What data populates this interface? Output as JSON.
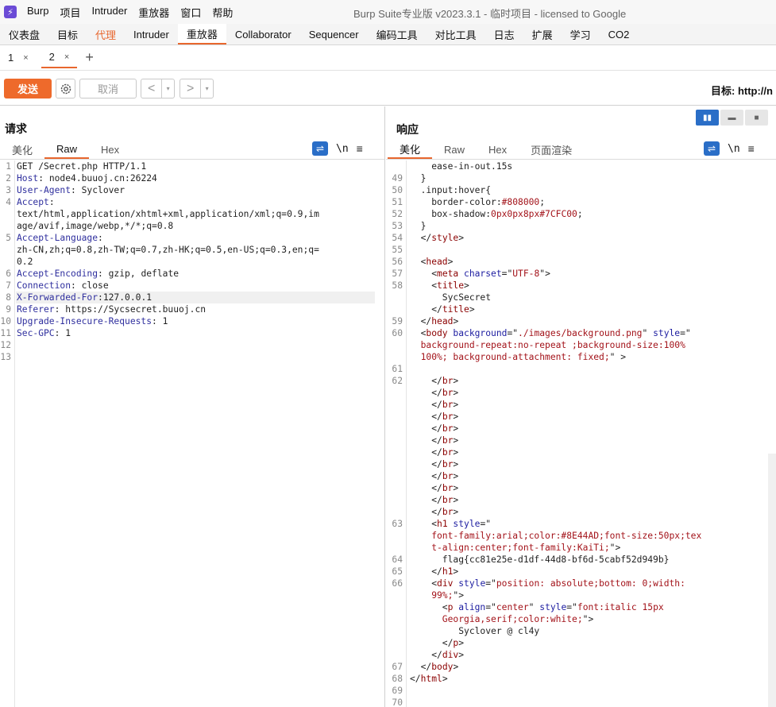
{
  "app": {
    "logo_glyph": "⚡",
    "menu": [
      "Burp",
      "项目",
      "Intruder",
      "重放器",
      "窗口",
      "帮助"
    ],
    "window_title": "Burp Suite专业版  v2023.3.1 - 临时项目 - licensed to Google"
  },
  "main_tabs": [
    "仪表盘",
    "目标",
    "代理",
    "Intruder",
    "重放器",
    "Collaborator",
    "Sequencer",
    "编码工具",
    "对比工具",
    "日志",
    "扩展",
    "学习",
    "CO2"
  ],
  "main_tab_active": "重放器",
  "sub_tabs": [
    {
      "label": "1",
      "close": "×"
    },
    {
      "label": "2",
      "close": "×"
    }
  ],
  "sub_tab_add": "+",
  "toolbar": {
    "send": "发送",
    "cancel": "取消",
    "back": "<",
    "forward": ">",
    "dropdown": "▾",
    "target_label": "目标: http://n"
  },
  "request": {
    "title": "请求",
    "tabs": [
      "美化",
      "Raw",
      "Hex"
    ],
    "active_tab": "Raw",
    "icons": {
      "wrap": "wrap-icon",
      "newline": "\\n",
      "menu": "≡"
    },
    "lines": [
      {
        "n": "1",
        "segs": [
          [
            "t",
            "GET /Secret.php HTTP/1.1"
          ]
        ]
      },
      {
        "n": "2",
        "segs": [
          [
            "k",
            "Host"
          ],
          [
            "t",
            ": node4.buuoj.cn:26224"
          ]
        ]
      },
      {
        "n": "3",
        "segs": [
          [
            "k",
            "User-Agent"
          ],
          [
            "t",
            ": Syclover"
          ]
        ]
      },
      {
        "n": "4",
        "segs": [
          [
            "k",
            "Accept"
          ],
          [
            "t",
            ":"
          ]
        ]
      },
      {
        "n": "",
        "segs": [
          [
            "t",
            "text/html,application/xhtml+xml,application/xml;q=0.9,im"
          ]
        ]
      },
      {
        "n": "",
        "segs": [
          [
            "t",
            "age/avif,image/webp,*/*;q=0.8"
          ]
        ]
      },
      {
        "n": "5",
        "segs": [
          [
            "k",
            "Accept-Language"
          ],
          [
            "t",
            ":"
          ]
        ]
      },
      {
        "n": "",
        "segs": [
          [
            "t",
            "zh-CN,zh;q=0.8,zh-TW;q=0.7,zh-HK;q=0.5,en-US;q=0.3,en;q="
          ]
        ]
      },
      {
        "n": "",
        "segs": [
          [
            "t",
            "0.2"
          ]
        ]
      },
      {
        "n": "6",
        "segs": [
          [
            "k",
            "Accept-Encoding"
          ],
          [
            "t",
            ": gzip, deflate"
          ]
        ]
      },
      {
        "n": "7",
        "segs": [
          [
            "k",
            "Connection"
          ],
          [
            "t",
            ": close"
          ]
        ]
      },
      {
        "n": "8",
        "segs": [
          [
            "k",
            "X-Forwarded-For"
          ],
          [
            "t",
            ":127.0.0.1"
          ]
        ],
        "highlight": true
      },
      {
        "n": "9",
        "segs": [
          [
            "k",
            "Referer"
          ],
          [
            "t",
            ": https://Sycsecret.buuoj.cn"
          ]
        ]
      },
      {
        "n": "10",
        "segs": [
          [
            "k",
            "Upgrade-Insecure-Requests"
          ],
          [
            "t",
            ": 1"
          ]
        ]
      },
      {
        "n": "11",
        "segs": [
          [
            "k",
            "Sec-GPC"
          ],
          [
            "t",
            ": 1"
          ]
        ]
      },
      {
        "n": "12",
        "segs": []
      },
      {
        "n": "13",
        "segs": []
      }
    ]
  },
  "response": {
    "title": "响应",
    "tabs": [
      "美化",
      "Raw",
      "Hex",
      "页面渲染"
    ],
    "active_tab": "美化",
    "icons": {
      "wrap": "wrap-icon",
      "newline": "\\n",
      "menu": "≡"
    },
    "layout_icons": [
      "split-horizontal-icon",
      "split-vertical-icon",
      "single-pane-icon"
    ],
    "lines": [
      {
        "n": "",
        "segs": [
          [
            "t",
            "    ease-in-out.15s"
          ]
        ]
      },
      {
        "n": "49",
        "segs": [
          [
            "t",
            "  }"
          ]
        ]
      },
      {
        "n": "50",
        "segs": [
          [
            "t",
            "  .input:hover{"
          ]
        ]
      },
      {
        "n": "51",
        "segs": [
          [
            "t",
            "    border-color:"
          ],
          [
            "v",
            "#808000"
          ],
          [
            "t",
            ";"
          ]
        ]
      },
      {
        "n": "52",
        "segs": [
          [
            "t",
            "    box-shadow:"
          ],
          [
            "v",
            "0px0px8px#7CFC00"
          ],
          [
            "t",
            ";"
          ]
        ]
      },
      {
        "n": "53",
        "segs": [
          [
            "t",
            "  }"
          ]
        ]
      },
      {
        "n": "54",
        "segs": [
          [
            "t",
            "  </"
          ],
          [
            "g",
            "style"
          ],
          [
            "t",
            ">"
          ]
        ]
      },
      {
        "n": "55",
        "segs": []
      },
      {
        "n": "56",
        "segs": [
          [
            "t",
            "  <"
          ],
          [
            "g",
            "head"
          ],
          [
            "t",
            ">"
          ]
        ]
      },
      {
        "n": "57",
        "segs": [
          [
            "t",
            "    <"
          ],
          [
            "g",
            "meta "
          ],
          [
            "a",
            "charset"
          ],
          [
            "t",
            "=\""
          ],
          [
            "v",
            "UTF-8"
          ],
          [
            "t",
            "\">"
          ]
        ]
      },
      {
        "n": "58",
        "segs": [
          [
            "t",
            "    <"
          ],
          [
            "g",
            "title"
          ],
          [
            "t",
            ">"
          ]
        ]
      },
      {
        "n": "",
        "segs": [
          [
            "t",
            "      SycSecret"
          ]
        ]
      },
      {
        "n": "",
        "segs": [
          [
            "t",
            "    </"
          ],
          [
            "g",
            "title"
          ],
          [
            "t",
            ">"
          ]
        ]
      },
      {
        "n": "59",
        "segs": [
          [
            "t",
            "  </"
          ],
          [
            "g",
            "head"
          ],
          [
            "t",
            ">"
          ]
        ]
      },
      {
        "n": "60",
        "segs": [
          [
            "t",
            "  <"
          ],
          [
            "g",
            "body "
          ],
          [
            "a",
            "background"
          ],
          [
            "t",
            "=\""
          ],
          [
            "v",
            "./images/background.png"
          ],
          [
            "t",
            "\" "
          ],
          [
            "a",
            "style"
          ],
          [
            "t",
            "=\""
          ]
        ]
      },
      {
        "n": "",
        "segs": [
          [
            "v",
            "  background-repeat:no-repeat ;background-size:100%"
          ]
        ]
      },
      {
        "n": "",
        "segs": [
          [
            "v",
            "  100%; background-attachment: fixed;"
          ],
          [
            "t",
            "\" >"
          ]
        ]
      },
      {
        "n": "61",
        "segs": []
      },
      {
        "n": "62",
        "segs": [
          [
            "t",
            "    </"
          ],
          [
            "g",
            "br"
          ],
          [
            "t",
            ">"
          ]
        ]
      },
      {
        "n": "",
        "segs": [
          [
            "t",
            "    </"
          ],
          [
            "g",
            "br"
          ],
          [
            "t",
            ">"
          ]
        ]
      },
      {
        "n": "",
        "segs": [
          [
            "t",
            "    </"
          ],
          [
            "g",
            "br"
          ],
          [
            "t",
            ">"
          ]
        ]
      },
      {
        "n": "",
        "segs": [
          [
            "t",
            "    </"
          ],
          [
            "g",
            "br"
          ],
          [
            "t",
            ">"
          ]
        ]
      },
      {
        "n": "",
        "segs": [
          [
            "t",
            "    </"
          ],
          [
            "g",
            "br"
          ],
          [
            "t",
            ">"
          ]
        ]
      },
      {
        "n": "",
        "segs": [
          [
            "t",
            "    </"
          ],
          [
            "g",
            "br"
          ],
          [
            "t",
            ">"
          ]
        ]
      },
      {
        "n": "",
        "segs": [
          [
            "t",
            "    </"
          ],
          [
            "g",
            "br"
          ],
          [
            "t",
            ">"
          ]
        ]
      },
      {
        "n": "",
        "segs": [
          [
            "t",
            "    </"
          ],
          [
            "g",
            "br"
          ],
          [
            "t",
            ">"
          ]
        ]
      },
      {
        "n": "",
        "segs": [
          [
            "t",
            "    </"
          ],
          [
            "g",
            "br"
          ],
          [
            "t",
            ">"
          ]
        ]
      },
      {
        "n": "",
        "segs": [
          [
            "t",
            "    </"
          ],
          [
            "g",
            "br"
          ],
          [
            "t",
            ">"
          ]
        ]
      },
      {
        "n": "",
        "segs": [
          [
            "t",
            "    </"
          ],
          [
            "g",
            "br"
          ],
          [
            "t",
            ">"
          ]
        ]
      },
      {
        "n": "",
        "segs": [
          [
            "t",
            "    </"
          ],
          [
            "g",
            "br"
          ],
          [
            "t",
            ">"
          ]
        ]
      },
      {
        "n": "63",
        "segs": [
          [
            "t",
            "    <"
          ],
          [
            "g",
            "h1 "
          ],
          [
            "a",
            "style"
          ],
          [
            "t",
            "=\""
          ]
        ]
      },
      {
        "n": "",
        "segs": [
          [
            "v",
            "    font-family:arial;color:#8E44AD;font-size:50px;tex"
          ]
        ]
      },
      {
        "n": "",
        "segs": [
          [
            "v",
            "    t-align:center;font-family:KaiTi;"
          ],
          [
            "t",
            "\">"
          ]
        ]
      },
      {
        "n": "64",
        "segs": [
          [
            "t",
            "      flag{cc81e25e-d1df-44d8-bf6d-5cabf52d949b}"
          ]
        ]
      },
      {
        "n": "65",
        "segs": [
          [
            "t",
            "    </"
          ],
          [
            "g",
            "h1"
          ],
          [
            "t",
            ">"
          ]
        ]
      },
      {
        "n": "66",
        "segs": [
          [
            "t",
            "    <"
          ],
          [
            "g",
            "div "
          ],
          [
            "a",
            "style"
          ],
          [
            "t",
            "=\""
          ],
          [
            "v",
            "position: absolute;bottom: 0;width:"
          ]
        ]
      },
      {
        "n": "",
        "segs": [
          [
            "v",
            "    99%;"
          ],
          [
            "t",
            "\">"
          ]
        ]
      },
      {
        "n": "",
        "segs": [
          [
            "t",
            "      <"
          ],
          [
            "g",
            "p "
          ],
          [
            "a",
            "align"
          ],
          [
            "t",
            "=\""
          ],
          [
            "v",
            "center"
          ],
          [
            "t",
            "\" "
          ],
          [
            "a",
            "style"
          ],
          [
            "t",
            "=\""
          ],
          [
            "v",
            "font:italic 15px"
          ]
        ]
      },
      {
        "n": "",
        "segs": [
          [
            "v",
            "      Georgia,serif;color:white;"
          ],
          [
            "t",
            "\">"
          ]
        ]
      },
      {
        "n": "",
        "segs": [
          [
            "t",
            "         Syclover @ cl4y"
          ]
        ]
      },
      {
        "n": "",
        "segs": [
          [
            "t",
            "      </"
          ],
          [
            "g",
            "p"
          ],
          [
            "t",
            ">"
          ]
        ]
      },
      {
        "n": "",
        "segs": [
          [
            "t",
            "    </"
          ],
          [
            "g",
            "div"
          ],
          [
            "t",
            ">"
          ]
        ]
      },
      {
        "n": "67",
        "segs": [
          [
            "t",
            "  </"
          ],
          [
            "g",
            "body"
          ],
          [
            "t",
            ">"
          ]
        ]
      },
      {
        "n": "68",
        "segs": [
          [
            "t",
            "</"
          ],
          [
            "g",
            "html"
          ],
          [
            "t",
            ">"
          ]
        ]
      },
      {
        "n": "69",
        "segs": []
      },
      {
        "n": "70",
        "segs": []
      }
    ]
  },
  "colors": {
    "accent": "#ee6a2b",
    "blue": "#2a6ec7"
  }
}
